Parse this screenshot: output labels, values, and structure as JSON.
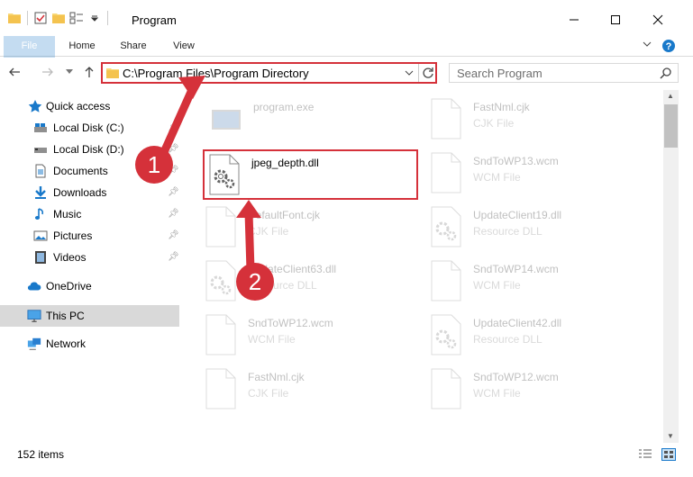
{
  "window": {
    "title": "Program"
  },
  "ribbon": {
    "tabs": [
      "File",
      "Home",
      "Share",
      "View"
    ]
  },
  "address": {
    "path": "C:\\Program Files\\Program Directory",
    "search_placeholder": "Search Program"
  },
  "sidebar": {
    "items": [
      {
        "label": "Quick access",
        "icon": "star-icon"
      },
      {
        "label": "Local Disk (C:)",
        "icon": "drive-icon"
      },
      {
        "label": "Local Disk (D:)",
        "icon": "drive-icon"
      },
      {
        "label": "Documents",
        "icon": "documents-icon"
      },
      {
        "label": "Downloads",
        "icon": "downloads-icon"
      },
      {
        "label": "Music",
        "icon": "music-icon"
      },
      {
        "label": "Pictures",
        "icon": "pictures-icon"
      },
      {
        "label": "Videos",
        "icon": "videos-icon"
      },
      {
        "label": "OneDrive",
        "icon": "cloud-icon"
      },
      {
        "label": "This PC",
        "icon": "pc-icon",
        "selected": true
      },
      {
        "label": "Network",
        "icon": "network-icon"
      }
    ]
  },
  "files": [
    {
      "name": "program.exe",
      "type": ""
    },
    {
      "name": "FastNml.cjk",
      "type": "CJK File"
    },
    {
      "name": "jpeg_depth.dll",
      "type": "",
      "highlighted": true
    },
    {
      "name": "SndToWP13.wcm",
      "type": "WCM File"
    },
    {
      "name": "DefaultFont.cjk",
      "type": "CJK File"
    },
    {
      "name": "UpdateClient19.dll",
      "type": "Resource DLL"
    },
    {
      "name": "UpdateClient63.dll",
      "type": "Resource DLL"
    },
    {
      "name": "SndToWP14.wcm",
      "type": "WCM File"
    },
    {
      "name": "SndToWP12.wcm",
      "type": "WCM File"
    },
    {
      "name": "UpdateClient42.dll",
      "type": "Resource DLL"
    },
    {
      "name": "FastNml.cjk",
      "type": "CJK File"
    },
    {
      "name": "SndToWP12.wcm",
      "type": "WCM File"
    }
  ],
  "status": {
    "item_count": "152 items"
  },
  "annotations": {
    "step1": "1",
    "step2": "2"
  },
  "colors": {
    "accent": "#1979ca",
    "highlight_red": "#d5313a",
    "selected_bg": "#d9d9d9"
  }
}
